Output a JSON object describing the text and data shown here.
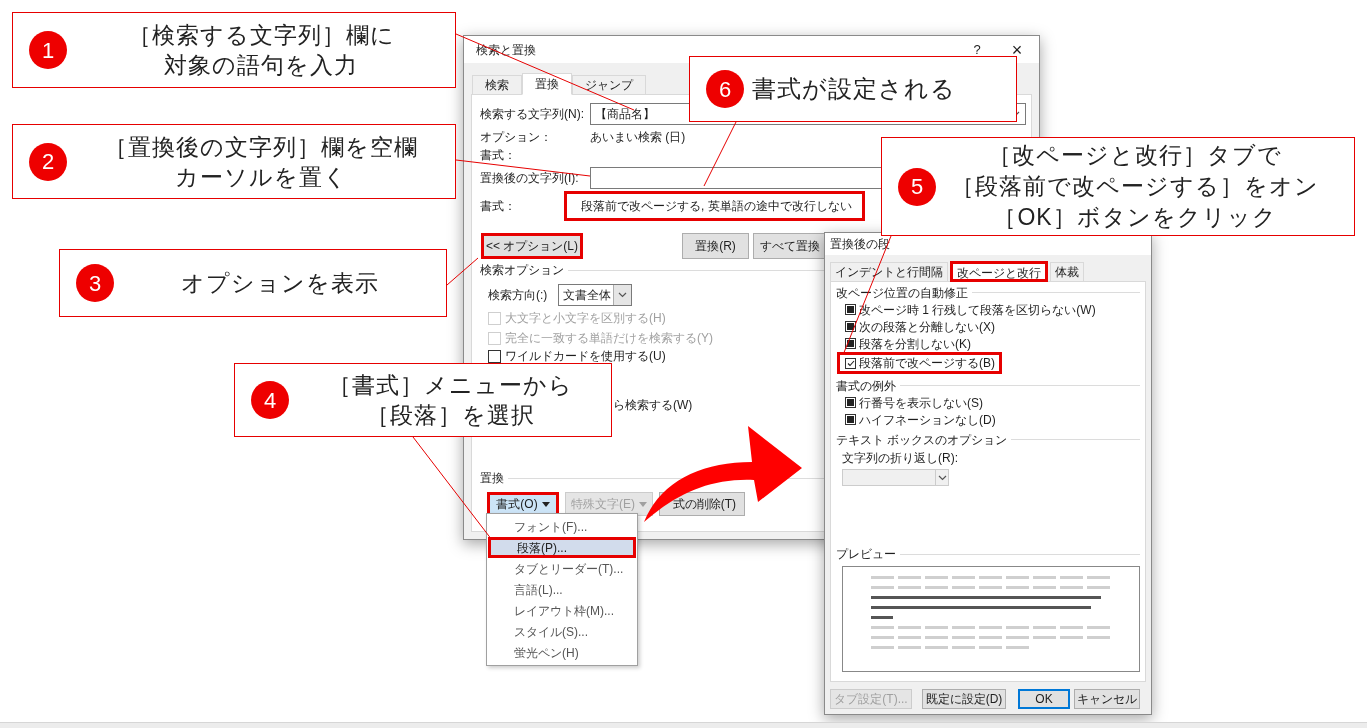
{
  "find_dialog": {
    "title": "検索と置換",
    "help": "?",
    "close": "×",
    "tabs": [
      {
        "label": "検索",
        "selected": false
      },
      {
        "label": "置換",
        "selected": true
      },
      {
        "label": "ジャンプ",
        "selected": false
      }
    ],
    "find_label": "検索する文字列(N):",
    "find_value": "【商品名】",
    "options_label": "オプション：",
    "options_value": "あいまい検索 (日)",
    "find_format_label": "書式：",
    "replace_label": "置換後の文字列(I):",
    "replace_format": {
      "label": "書式：",
      "value": "段落前で改ページする, 英単語の途中で改行しない",
      "highlighted": true
    },
    "buttons": [
      {
        "label": "<< オプション(L)",
        "highlighted": true
      },
      {
        "label": "置換(R)",
        "highlighted": false
      },
      {
        "label": "すべて置換",
        "highlighted": false
      }
    ],
    "search_options": {
      "title": "検索オプション",
      "direction_label": "検索方向(:)",
      "direction_value": "文書全体",
      "checkboxes": [
        {
          "label": "大文字と小文字を区別する(H)",
          "checked": false,
          "disabled": true
        },
        {
          "label": "完全に一致する単語だけを検索する(Y)",
          "checked": false,
          "disabled": true
        },
        {
          "label": "ワイルドカードを使用する(U)",
          "checked": false,
          "disabled": false
        }
      ],
      "partial_text": "ら検索する(W)"
    },
    "replace_section": {
      "title": "置換",
      "buttons": [
        {
          "label": "書式(O)",
          "dropdown": true,
          "pressed": true,
          "disabled": false,
          "highlighted": true
        },
        {
          "label": "特殊文字(E)",
          "dropdown": true,
          "pressed": false,
          "disabled": true,
          "highlighted": false
        },
        {
          "label": "式の削除(T)",
          "dropdown": false,
          "pressed": false,
          "disabled": false,
          "highlighted": false
        }
      ]
    }
  },
  "format_menu": {
    "items": [
      {
        "label": "フォント(F)...",
        "selected": false,
        "highlighted": false
      },
      {
        "label": "段落(P)...",
        "selected": true,
        "highlighted": true
      },
      {
        "label": "タブとリーダー(T)...",
        "selected": false,
        "highlighted": false
      },
      {
        "label": "言語(L)...",
        "selected": false,
        "highlighted": false
      },
      {
        "label": "レイアウト枠(M)...",
        "selected": false,
        "highlighted": false
      },
      {
        "label": "スタイル(S)...",
        "selected": false,
        "highlighted": false
      },
      {
        "label": "蛍光ペン(H)",
        "selected": false,
        "highlighted": false
      }
    ]
  },
  "paragraph_dialog": {
    "title": "置換後の段",
    "tabs": [
      {
        "label": "インデントと行間隔",
        "selected": false,
        "highlighted": false
      },
      {
        "label": "改ページと改行",
        "selected": true,
        "highlighted": true
      },
      {
        "label": "体裁",
        "selected": false,
        "highlighted": false
      }
    ],
    "sections": [
      {
        "title": "改ページ位置の自動修正",
        "items": [
          {
            "kind": "checkbox",
            "label": "改ページ時 1 行残して段落を区切らない(W)",
            "checked": false,
            "indeterminate": true,
            "highlighted": false
          },
          {
            "kind": "checkbox",
            "label": "次の段落と分離しない(X)",
            "checked": false,
            "indeterminate": true,
            "highlighted": false
          },
          {
            "kind": "checkbox",
            "label": "段落を分割しない(K)",
            "checked": false,
            "indeterminate": true,
            "highlighted": false
          },
          {
            "kind": "checkbox",
            "label": "段落前で改ページする(B)",
            "checked": true,
            "indeterminate": false,
            "highlighted": true
          }
        ]
      },
      {
        "title": "書式の例外",
        "items": [
          {
            "kind": "checkbox",
            "label": "行番号を表示しない(S)",
            "checked": false,
            "indeterminate": true,
            "highlighted": false
          },
          {
            "kind": "checkbox",
            "label": "ハイフネーションなし(D)",
            "checked": false,
            "indeterminate": true,
            "highlighted": false
          }
        ]
      },
      {
        "title": "テキスト ボックスのオプション",
        "items": [
          {
            "kind": "select",
            "label": "文字列の折り返し(R):",
            "disabled": true
          }
        ]
      }
    ],
    "preview": {
      "title": "プレビュー"
    },
    "buttons": [
      {
        "label": "タブ設定(T)...",
        "disabled": true,
        "default": false
      },
      {
        "label": "既定に設定(D)",
        "disabled": false,
        "default": false
      },
      {
        "label": "OK",
        "disabled": false,
        "default": true
      },
      {
        "label": "キャンセル",
        "disabled": false,
        "default": false
      }
    ]
  },
  "callouts": [
    {
      "number": "1",
      "lines": [
        "［検索する文字列］欄に",
        "対象の語句を入力"
      ]
    },
    {
      "number": "2",
      "lines": [
        "［置換後の文字列］欄を空欄",
        "カーソルを置く"
      ]
    },
    {
      "number": "3",
      "lines": [
        "オプションを表示"
      ]
    },
    {
      "number": "4",
      "lines": [
        "［書式］メニューから",
        "［段落］を選択"
      ]
    },
    {
      "number": "5",
      "lines": [
        "［改ページと改行］タブで",
        "［段落前で改ページする］をオン",
        "［OK］ボタンをクリック"
      ]
    },
    {
      "number": "6",
      "lines": [
        "書式が設定される"
      ]
    }
  ]
}
